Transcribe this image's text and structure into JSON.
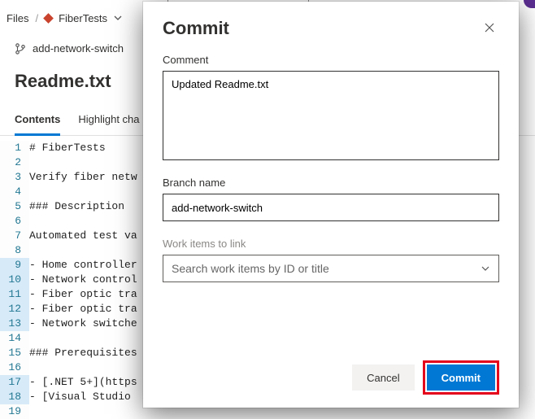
{
  "breadcrumb": {
    "root": "Files",
    "project": "FiberTests"
  },
  "branch": "add-network-switch",
  "page_title": "Readme.txt",
  "tabs": {
    "contents": "Contents",
    "highlight": "Highlight cha"
  },
  "editor_lines": [
    {
      "n": 1,
      "mod": false,
      "text": "# FiberTests"
    },
    {
      "n": 2,
      "mod": false,
      "text": ""
    },
    {
      "n": 3,
      "mod": false,
      "text": "Verify fiber netw"
    },
    {
      "n": 4,
      "mod": false,
      "text": ""
    },
    {
      "n": 5,
      "mod": false,
      "text": "### Description"
    },
    {
      "n": 6,
      "mod": false,
      "text": ""
    },
    {
      "n": 7,
      "mod": false,
      "text": "Automated test va"
    },
    {
      "n": 8,
      "mod": false,
      "text": ""
    },
    {
      "n": 9,
      "mod": true,
      "text": "- Home controller"
    },
    {
      "n": 10,
      "mod": true,
      "text": "- Network control"
    },
    {
      "n": 11,
      "mod": true,
      "text": "- Fiber optic tra"
    },
    {
      "n": 12,
      "mod": true,
      "text": "- Fiber optic tra"
    },
    {
      "n": 13,
      "mod": true,
      "text": "- Network switche"
    },
    {
      "n": 14,
      "mod": false,
      "text": ""
    },
    {
      "n": 15,
      "mod": false,
      "text": "### Prerequisites"
    },
    {
      "n": 16,
      "mod": false,
      "text": ""
    },
    {
      "n": 17,
      "mod": true,
      "text": "- [.NET 5+](https"
    },
    {
      "n": 18,
      "mod": true,
      "text": "- [Visual Studio "
    },
    {
      "n": 19,
      "mod": false,
      "text": ""
    }
  ],
  "dialog": {
    "title": "Commit",
    "comment_label": "Comment",
    "comment_value": "Updated Readme.txt",
    "branch_label": "Branch name",
    "branch_value": "add-network-switch",
    "workitems_label": "Work items to link",
    "workitems_placeholder": "Search work items by ID or title",
    "cancel": "Cancel",
    "commit": "Commit"
  }
}
